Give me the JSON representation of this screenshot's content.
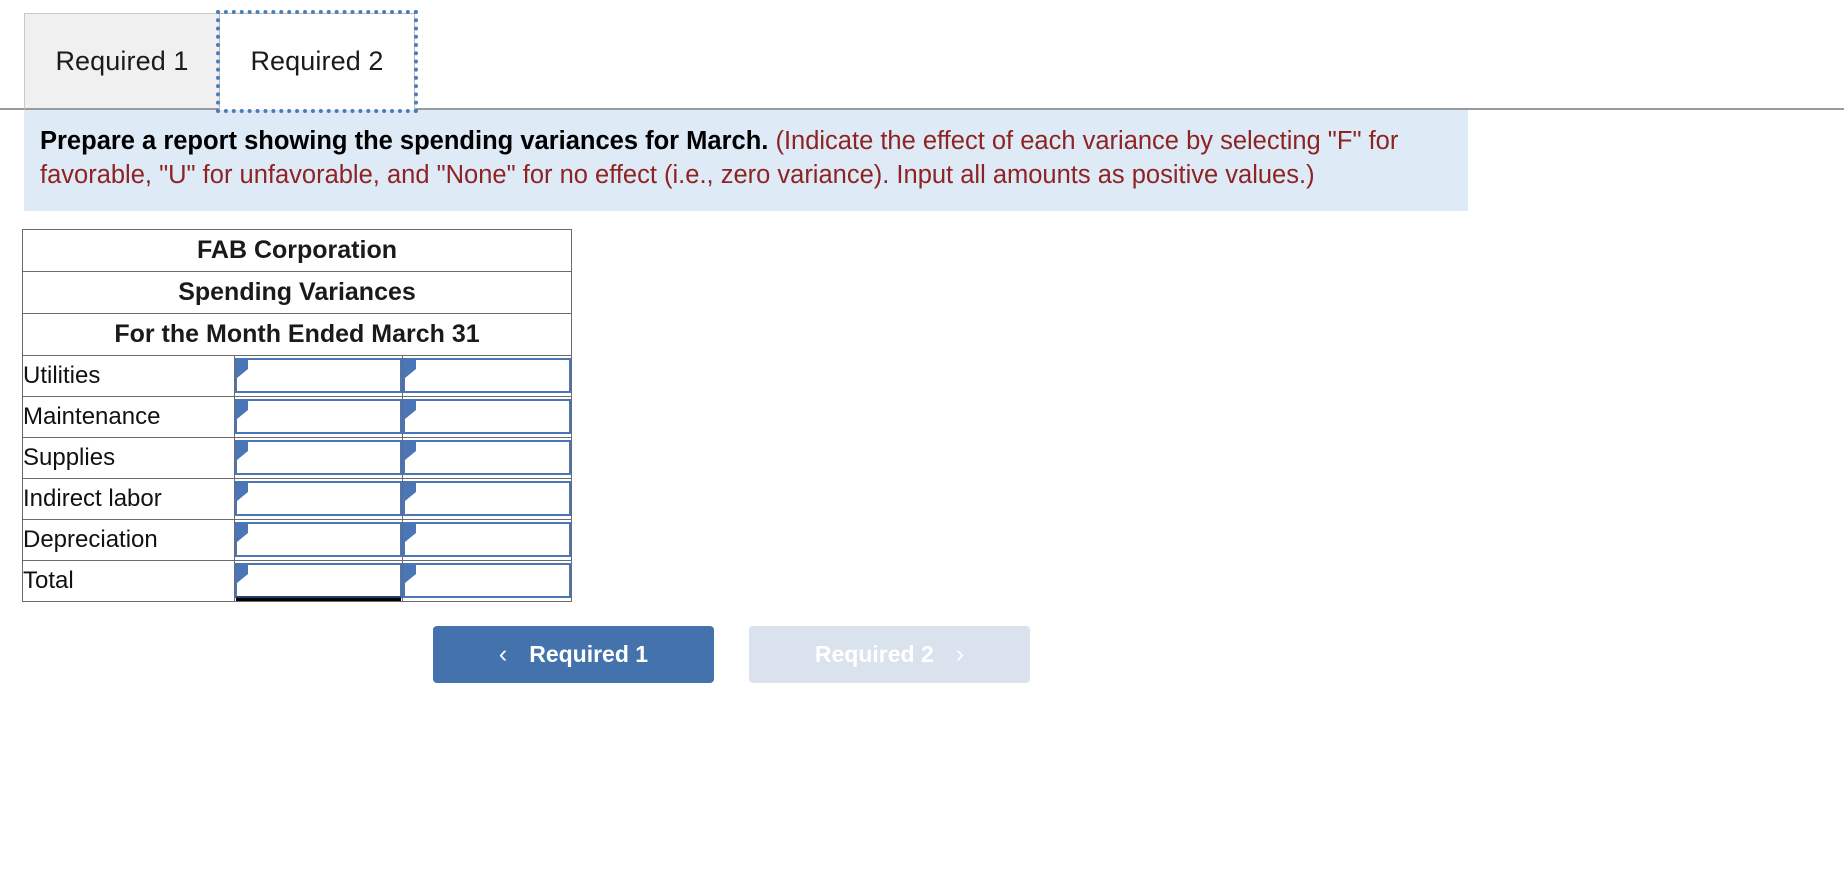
{
  "tabs": [
    {
      "label": "Required 1",
      "active": false
    },
    {
      "label": "Required 2",
      "active": true
    }
  ],
  "instruction": {
    "prompt": "Prepare a report showing the spending variances for March.",
    "note": "(Indicate the effect of each variance by selecting \"F\" for favorable, \"U\" for unfavorable, and \"None\" for no effect (i.e., zero variance). Input all amounts as positive values.)"
  },
  "worksheet": {
    "title_lines": [
      "FAB Corporation",
      "Spending Variances",
      "For the Month Ended March 31"
    ],
    "rows": [
      {
        "label": "Utilities",
        "amount": "",
        "effect": ""
      },
      {
        "label": "Maintenance",
        "amount": "",
        "effect": ""
      },
      {
        "label": "Supplies",
        "amount": "",
        "effect": ""
      },
      {
        "label": "Indirect labor",
        "amount": "",
        "effect": ""
      },
      {
        "label": "Depreciation",
        "amount": "",
        "effect": ""
      },
      {
        "label": "Total",
        "amount": "",
        "effect": ""
      }
    ]
  },
  "nav": {
    "prev": {
      "label": "Required 1",
      "icon": "chevron-left-icon",
      "glyph": "‹",
      "enabled": true
    },
    "next": {
      "label": "Required 2",
      "icon": "chevron-right-icon",
      "glyph": "›",
      "enabled": false
    }
  },
  "colors": {
    "header_blue": "#80a9dd",
    "banner_blue": "#deeaf6",
    "note_red": "#8e2323",
    "input_border": "#4a76b8",
    "primary_button": "#4472ad",
    "disabled_button": "#dae2ed"
  }
}
